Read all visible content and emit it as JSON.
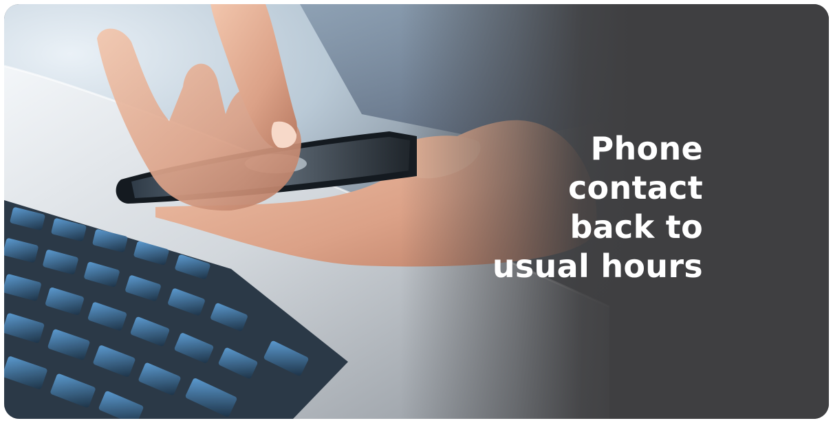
{
  "banner": {
    "headline_lines": [
      "Phone",
      "contact",
      "back to",
      "usual hours"
    ],
    "background_color": "#3f3f41",
    "text_color": "#ffffff",
    "image_description_icon": "hand-using-smartphone-over-laptop-photo"
  }
}
